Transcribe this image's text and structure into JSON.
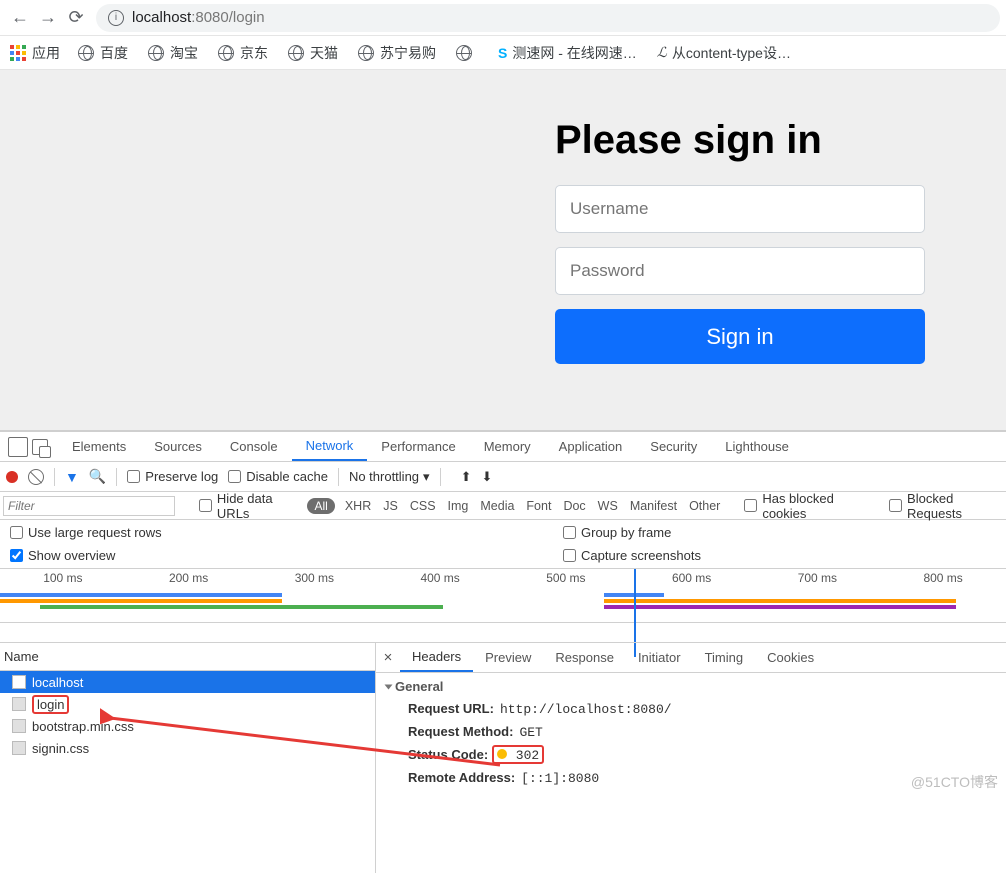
{
  "address": {
    "host": "localhost",
    "port": ":8080",
    "path": "/login"
  },
  "bookmarks": {
    "apps_label": "应用",
    "items": [
      "百度",
      "淘宝",
      "京东",
      "天猫",
      "苏宁易购",
      ""
    ],
    "speed": "测速网 - 在线网速…",
    "content": "从content-type设…"
  },
  "signin": {
    "title": "Please sign in",
    "user_ph": "Username",
    "pass_ph": "Password",
    "btn": "Sign in"
  },
  "dtabs": [
    "Elements",
    "Sources",
    "Console",
    "Network",
    "Performance",
    "Memory",
    "Application",
    "Security",
    "Lighthouse"
  ],
  "toolbar": {
    "preserve": "Preserve log",
    "disable": "Disable cache",
    "throttle": "No throttling"
  },
  "filter": {
    "placeholder": "Filter",
    "hide": "Hide data URLs",
    "all": "All",
    "types": [
      "XHR",
      "JS",
      "CSS",
      "Img",
      "Media",
      "Font",
      "Doc",
      "WS",
      "Manifest",
      "Other"
    ],
    "blocked_cookies": "Has blocked cookies",
    "blocked_req": "Blocked Requests"
  },
  "opts": {
    "large": "Use large request rows",
    "overview": "Show overview",
    "group": "Group by frame",
    "capture": "Capture screenshots"
  },
  "timeline_ticks": [
    "100 ms",
    "200 ms",
    "300 ms",
    "400 ms",
    "500 ms",
    "600 ms",
    "700 ms",
    "800 ms"
  ],
  "reqlist": {
    "header": "Name",
    "rows": [
      "localhost",
      "login",
      "bootstrap.min.css",
      "signin.css"
    ]
  },
  "detail": {
    "tabs": [
      "Headers",
      "Preview",
      "Response",
      "Initiator",
      "Timing",
      "Cookies"
    ],
    "section": "General",
    "url_lab": "Request URL:",
    "url_val": "http://localhost:8080/",
    "method_lab": "Request Method:",
    "method_val": "GET",
    "status_lab": "Status Code:",
    "status_val": "302",
    "remote_lab": "Remote Address:",
    "remote_val": "[::1]:8080"
  },
  "watermark": "@51CTO博客"
}
